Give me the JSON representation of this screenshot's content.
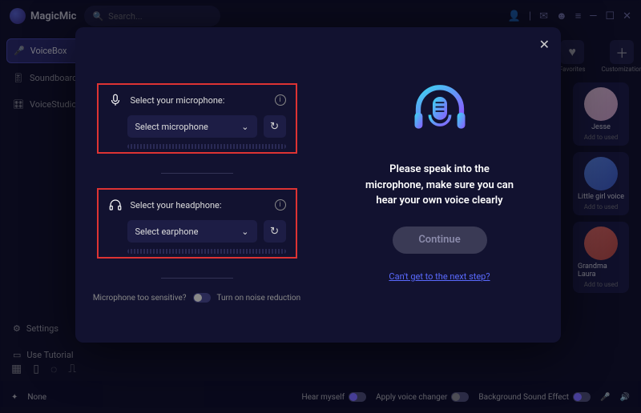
{
  "app": {
    "name": "MagicMic",
    "search_placeholder": "Search..."
  },
  "sidebar": {
    "items": [
      {
        "label": "VoiceBox"
      },
      {
        "label": "Soundboard"
      },
      {
        "label": "VoiceStudio"
      }
    ],
    "bottom": [
      {
        "label": "Settings"
      },
      {
        "label": "Use Tutorial"
      }
    ]
  },
  "right_rail": {
    "favorites_label": "Favorites",
    "custom_label": "Customization",
    "voices": [
      {
        "name": "Jesse",
        "add": "Add to used"
      },
      {
        "name": "Little girl voice",
        "add": "Add to used"
      },
      {
        "name": "Grandma Laura",
        "add": "Add to used"
      }
    ]
  },
  "modal": {
    "mic_label": "Select your microphone:",
    "mic_select": "Select microphone",
    "hp_label": "Select your headphone:",
    "hp_select": "Select earphone",
    "noise_q": "Microphone too sensitive?",
    "noise_toggle": "Turn on noise reduction",
    "instruction": "Please speak into the microphone, make sure you can hear your own voice clearly",
    "continue": "Continue",
    "help": "Can't get to the next step?"
  },
  "bottom": {
    "preset": "None",
    "hear": "Hear myself",
    "apply": "Apply voice changer",
    "bg": "Background Sound Effect"
  }
}
